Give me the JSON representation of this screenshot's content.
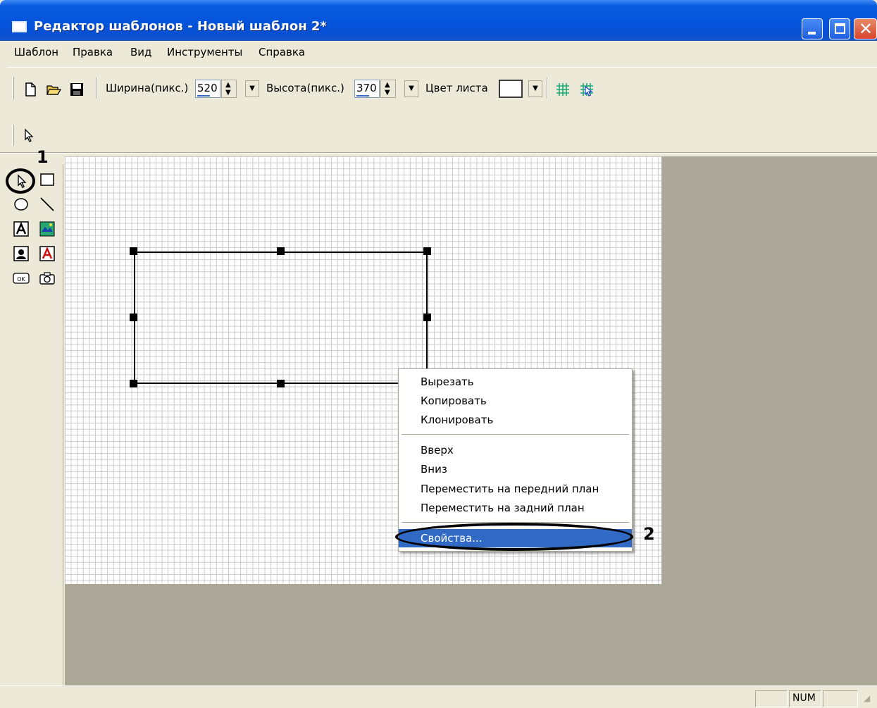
{
  "window": {
    "title": "Редактор шаблонов - Новый шаблон 2*",
    "close_glyph": "✕"
  },
  "menu": [
    "Шаблон",
    "Правка",
    "Вид",
    "Инструменты",
    "Справка"
  ],
  "toolbar": {
    "width_label": "Ширина(пикс.)",
    "width_value": "520",
    "height_label": "Высота(пикс.)",
    "height_value": "370",
    "color_label": "Цвет листа",
    "spin_up": "▲",
    "spin_down": "▼",
    "dropdown": "▼"
  },
  "palette": {
    "callout": "1"
  },
  "context_menu": {
    "items": [
      "Вырезать",
      "Копировать",
      "Клонировать",
      "Вверх",
      "Вниз",
      "Переместить на передний план",
      "Переместить на задний план",
      "Свойства..."
    ],
    "selected_index": 7,
    "callout": "2"
  },
  "statusbar": {
    "num": "NUM"
  },
  "colors": {
    "titlebar": "#0453db",
    "selection": "#316ac5",
    "workarea": "#aca899",
    "grid": "#c8c8c8"
  }
}
